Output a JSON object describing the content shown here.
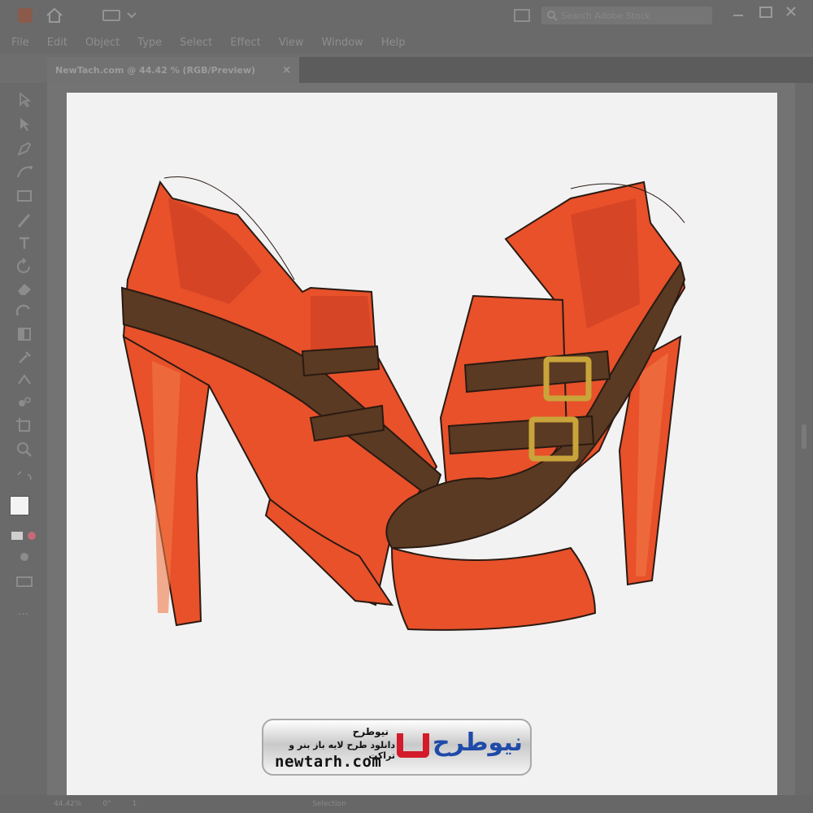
{
  "app": {
    "menu": [
      "File",
      "Edit",
      "Object",
      "Type",
      "Select",
      "Effect",
      "View",
      "Window",
      "Help"
    ],
    "search_placeholder": "Search Adobe Stock"
  },
  "document": {
    "tab_title": "NewTach.com @ 44.42 % (RGB/Preview)",
    "close_glyph": "×"
  },
  "status": {
    "zoom": "44.42%",
    "rotation": "0°",
    "artboard": "1",
    "tool": "Selection"
  },
  "watermark": {
    "title": "نیوطرح",
    "subtitle": "دانلود طرح لایه باز بنر و تراکت",
    "site": "newtarh.com",
    "logo_text": "نیوطرح"
  },
  "colors": {
    "shoe_orange": "#e8512a",
    "shoe_dark": "#c43a20",
    "strap_brown": "#5a3a22",
    "buckle_gold": "#c9a43a"
  }
}
